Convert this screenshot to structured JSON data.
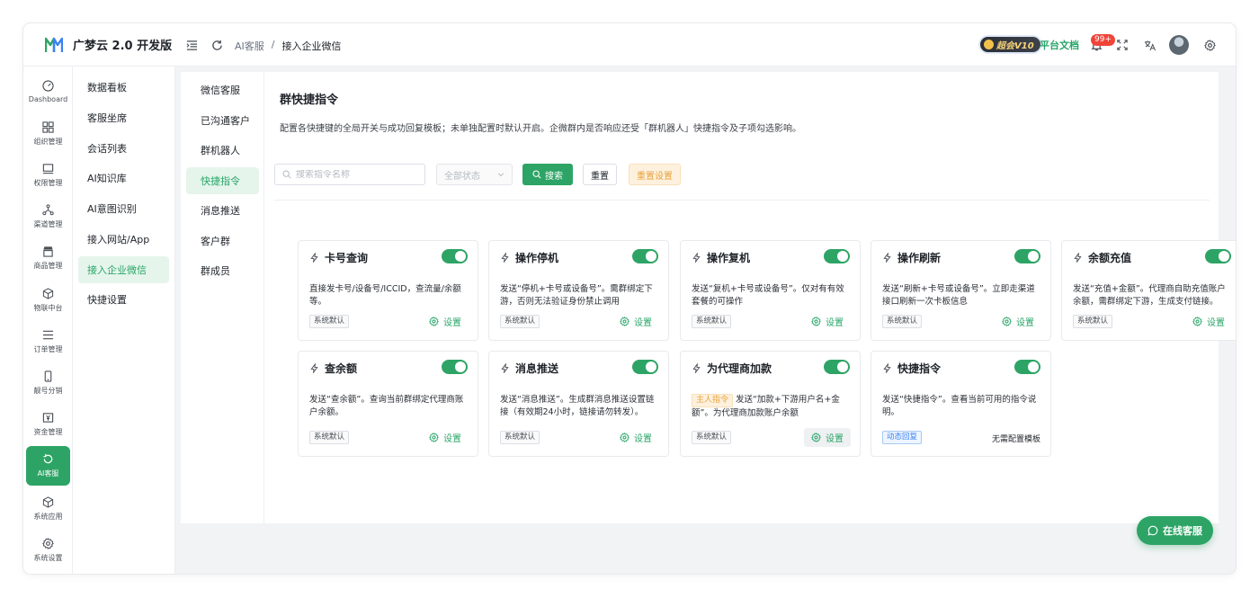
{
  "brand": {
    "name": "广梦云 2.0 开发版"
  },
  "header": {
    "breadcrumb": [
      "AI客服",
      "/",
      "接入企业微信"
    ],
    "vip_label": "超会V10",
    "doc_link": "平台文档",
    "notification_count": "99+"
  },
  "rail": {
    "items": [
      {
        "label": "Dashboard",
        "icon": "dashboard-icon"
      },
      {
        "label": "组织管理",
        "icon": "grid-icon"
      },
      {
        "label": "权限管理",
        "icon": "monitor-icon"
      },
      {
        "label": "渠道管理",
        "icon": "network-icon"
      },
      {
        "label": "商品管理",
        "icon": "store-icon"
      },
      {
        "label": "物联中台",
        "icon": "cube-icon"
      },
      {
        "label": "订单管理",
        "icon": "list-icon"
      },
      {
        "label": "靓号分销",
        "icon": "phone-icon"
      },
      {
        "label": "资金管理",
        "icon": "yen-icon"
      },
      {
        "label": "AI客服",
        "icon": "ai-icon",
        "active": true
      },
      {
        "label": "系统应用",
        "icon": "box-icon"
      },
      {
        "label": "系统设置",
        "icon": "gear-icon"
      }
    ]
  },
  "submenu": {
    "items": [
      {
        "label": "数据看板"
      },
      {
        "label": "客服坐席"
      },
      {
        "label": "会话列表"
      },
      {
        "label": "AI知识库"
      },
      {
        "label": "AI意图识别"
      },
      {
        "label": "接入网站/App"
      },
      {
        "label": "接入企业微信",
        "active": true
      },
      {
        "label": "快捷设置"
      }
    ]
  },
  "thirdmenu": {
    "items": [
      {
        "label": "微信客服"
      },
      {
        "label": "已沟通客户"
      },
      {
        "label": "群机器人"
      },
      {
        "label": "快捷指令",
        "active": true
      },
      {
        "label": "消息推送"
      },
      {
        "label": "客户群"
      },
      {
        "label": "群成员"
      }
    ]
  },
  "page": {
    "title": "群快捷指令",
    "description": "配置各快捷键的全局开关与成功回复模板；未单独配置时默认开启。企微群内是否响应还受「群机器人」快捷指令及子项勾选影响。"
  },
  "filters": {
    "search_placeholder": "搜索指令名称",
    "status_placeholder": "全部状态",
    "search_button": "搜索",
    "reset_button": "重置",
    "reset_settings_button": "重置设置"
  },
  "cards": [
    {
      "title": "卡号查询",
      "enabled": true,
      "desc": "直接发卡号/设备号/ICCID，查流量/余额等。",
      "tag": "系统默认",
      "action": "设置"
    },
    {
      "title": "操作停机",
      "enabled": true,
      "desc": "发送“停机+卡号或设备号”。需群绑定下游，否则无法验证身份禁止调用",
      "tag": "系统默认",
      "action": "设置"
    },
    {
      "title": "操作复机",
      "enabled": true,
      "desc": "发送“复机+卡号或设备号”。仅对有有效套餐的可操作",
      "tag": "系统默认",
      "action": "设置"
    },
    {
      "title": "操作刷新",
      "enabled": true,
      "desc": "发送“刷新+卡号或设备号”。立即走渠道接口刷新一次卡板信息",
      "tag": "系统默认",
      "action": "设置"
    },
    {
      "title": "余额充值",
      "enabled": true,
      "desc": "发送“充值+金额”。代理商自助充值账户余额，需群绑定下游，生成支付链接。",
      "tag": "系统默认",
      "action": "设置"
    },
    {
      "title": "查余额",
      "enabled": true,
      "desc": "发送“查余额”。查询当前群绑定代理商账户余额。",
      "tag": "系统默认",
      "action": "设置"
    },
    {
      "title": "消息推送",
      "enabled": true,
      "desc": "发送“消息推送”。生成群消息推送设置链接（有效期24小时，链接请勿转发）。",
      "tag": "系统默认",
      "action": "设置"
    },
    {
      "title": "为代理商加款",
      "enabled": true,
      "badge": "主人指令",
      "desc": "发送“加款+下游用户名+金额”。为代理商加款账户余额",
      "tag": "系统默认",
      "action": "设置"
    },
    {
      "title": "快捷指令",
      "enabled": true,
      "desc": "发送“快捷指令”。查看当前可用的指令说明。",
      "tag": "动态回复",
      "note": "无需配置模板"
    }
  ],
  "service_button": "在线客服",
  "colors": {
    "accent": "#2da465",
    "warning": "#e9a23b",
    "info": "#3b82f6"
  }
}
